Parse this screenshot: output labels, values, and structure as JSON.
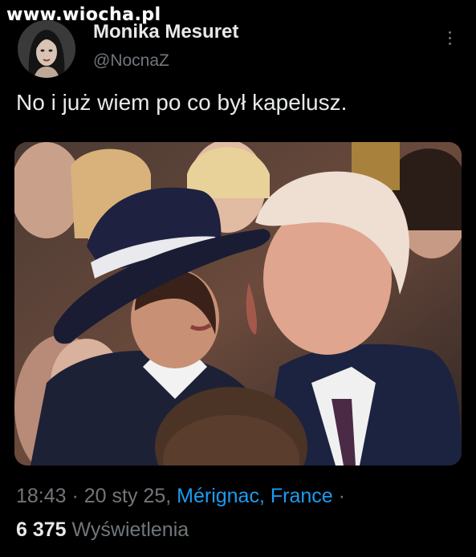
{
  "watermark": "www.wiocha.pl",
  "author": {
    "display_name": "Monika Mesuret",
    "handle": "@NocnaZ"
  },
  "tweet": {
    "text": "No i już wiem po co był kapelusz.",
    "time": "18:43",
    "separator": " · ",
    "date": "20 sty 25,",
    "location": "Mérignac, France",
    "trailing_separator": " ·",
    "views_count": "6 375",
    "views_label": "Wyświetlenia"
  },
  "icons": {
    "more": "more-vertical-icon"
  },
  "colors": {
    "background": "#000000",
    "primary_text": "#e7e9ea",
    "secondary_text": "#71767b",
    "link": "#1d9bf0"
  }
}
